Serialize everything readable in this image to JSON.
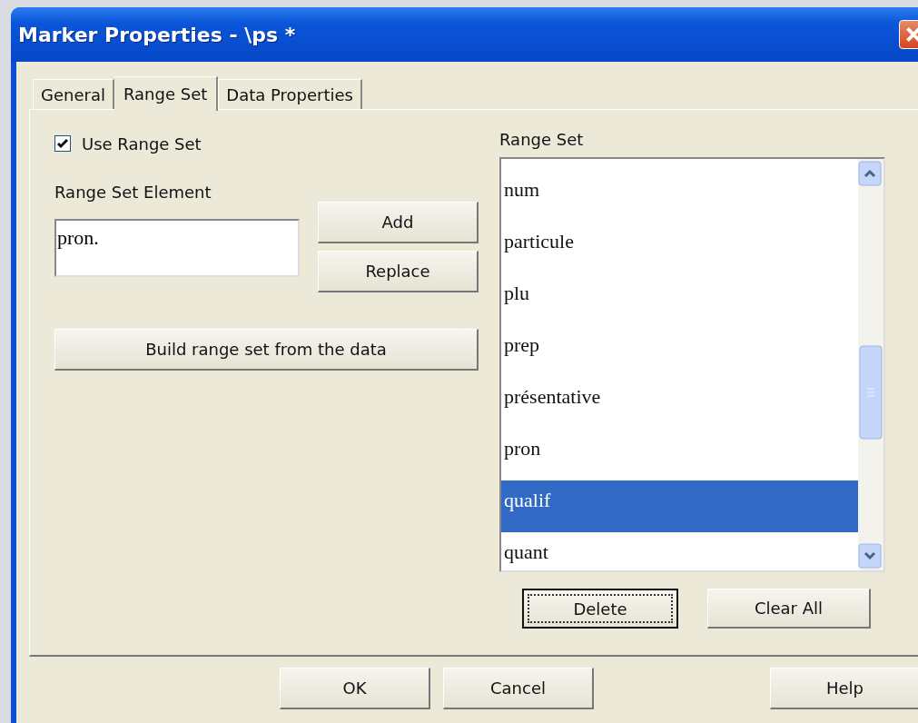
{
  "window": {
    "title": "Marker Properties - \\ps *"
  },
  "tabs": [
    {
      "label": "General",
      "selected": false
    },
    {
      "label": "Range Set",
      "selected": true
    },
    {
      "label": "Data Properties",
      "selected": false
    }
  ],
  "use_range_set": {
    "label": "Use Range Set",
    "checked": true
  },
  "element_field": {
    "label": "Range Set Element",
    "value": "pron."
  },
  "element_buttons": [
    {
      "label": "Add",
      "focused": false
    },
    {
      "label": "Replace",
      "focused": false
    }
  ],
  "build_button": {
    "label": "Build range set from the data",
    "focused": false
  },
  "range_set": {
    "label": "Range Set",
    "items": [
      {
        "text": "num",
        "selected": false
      },
      {
        "text": "particule",
        "selected": false
      },
      {
        "text": "plu",
        "selected": false
      },
      {
        "text": "prep",
        "selected": false
      },
      {
        "text": "présentative",
        "selected": false
      },
      {
        "text": "pron",
        "selected": false
      },
      {
        "text": "qualif",
        "selected": true
      },
      {
        "text": "quant",
        "selected": false
      }
    ]
  },
  "list_buttons": [
    {
      "label": "Delete",
      "focused": true
    },
    {
      "label": "Clear All",
      "focused": false
    }
  ],
  "dialog_buttons": [
    {
      "label": "OK",
      "focused": false
    },
    {
      "label": "Cancel",
      "focused": false
    },
    {
      "label": "Help",
      "focused": false
    }
  ]
}
